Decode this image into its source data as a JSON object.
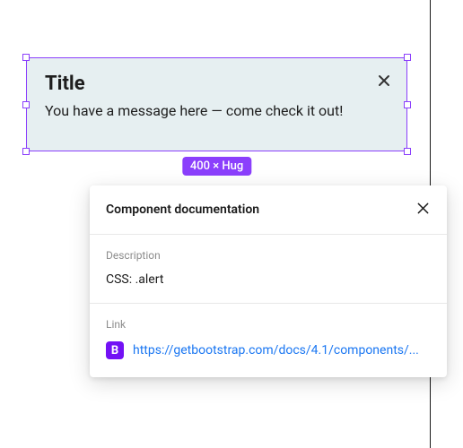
{
  "alert": {
    "title": "Title",
    "message": "You have a message here — come check it out!",
    "dimensions_badge": "400 × Hug"
  },
  "doc_panel": {
    "header_title": "Component documentation",
    "description": {
      "label": "Description",
      "value": "CSS: .alert"
    },
    "link": {
      "label": "Link",
      "favicon_letter": "B",
      "url_text": "https://getbootstrap.com/docs/4.1/components/..."
    }
  }
}
